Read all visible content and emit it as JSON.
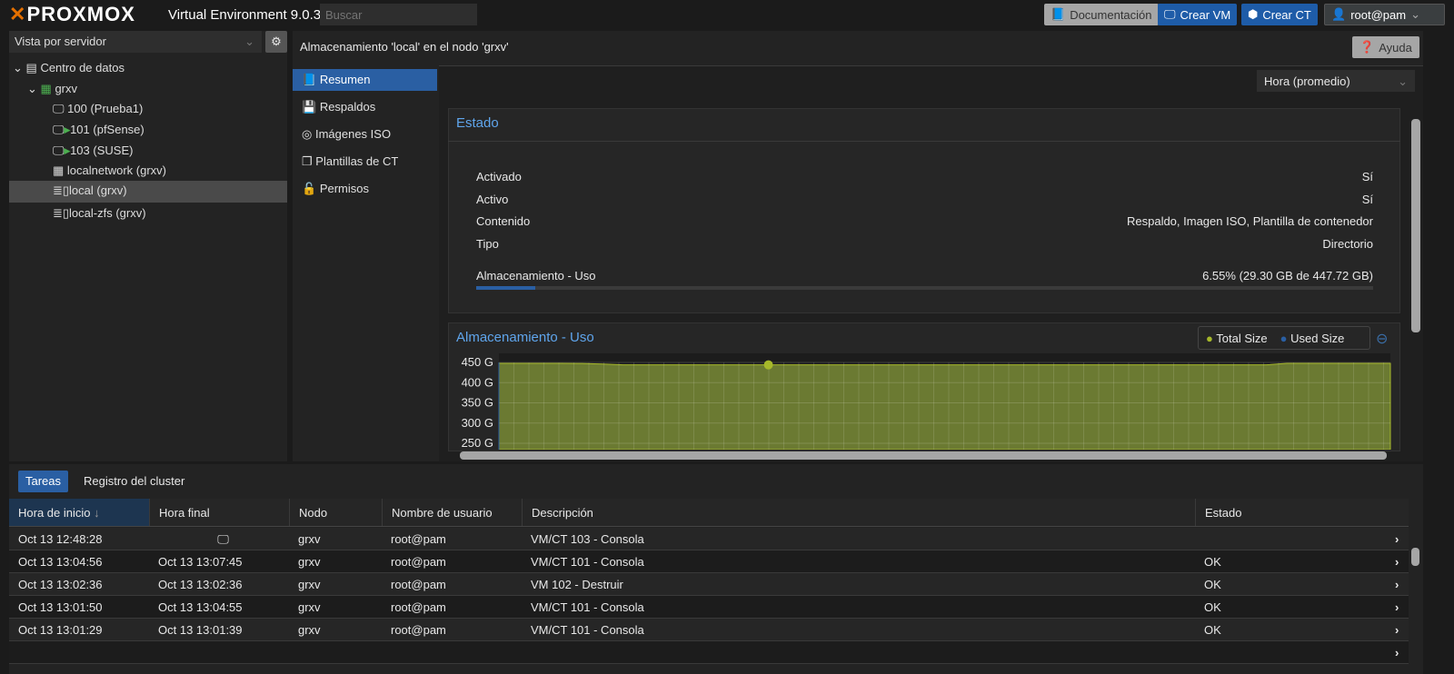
{
  "header": {
    "brand": "PROXMOX",
    "product": "Virtual Environment 9.0.3",
    "search_placeholder": "Buscar",
    "docs": "Documentación",
    "create_vm": "Crear VM",
    "create_ct": "Crear CT",
    "user": "root@pam"
  },
  "sidebar": {
    "view": "Vista por servidor",
    "tree": [
      {
        "label": "Centro de datos",
        "icon": "datacenter-icon"
      },
      {
        "label": "grxv",
        "icon": "node-online-icon"
      },
      {
        "label": "100 (Prueba1)",
        "icon": "vm-stopped-icon"
      },
      {
        "label": "101 (pfSense)",
        "icon": "vm-running-icon"
      },
      {
        "label": "103 (SUSE)",
        "icon": "vm-running-icon"
      },
      {
        "label": "localnetwork (grxv)",
        "icon": "network-icon"
      },
      {
        "label": "local (grxv)",
        "icon": "storage-icon",
        "selected": true
      },
      {
        "label": "local-zfs (grxv)",
        "icon": "storage-icon"
      }
    ]
  },
  "content": {
    "title": "Almacenamiento 'local' en el nodo 'grxv'",
    "help": "Ayuda",
    "nav": [
      "Resumen",
      "Respaldos",
      "Imágenes ISO",
      "Plantillas de CT",
      "Permisos"
    ],
    "timeframe": "Hora (promedio)"
  },
  "status": {
    "title": "Estado",
    "rows": [
      {
        "k": "Activado",
        "v": "Sí"
      },
      {
        "k": "Activo",
        "v": "Sí"
      },
      {
        "k": "Contenido",
        "v": "Respaldo, Imagen ISO, Plantilla de contenedor"
      },
      {
        "k": "Tipo",
        "v": "Directorio"
      }
    ],
    "usage_label": "Almacenamiento - Uso",
    "usage_text": "6.55% (29.30 GB de 447.72 GB)",
    "usage_pct": 6.55
  },
  "chart_data": {
    "type": "area",
    "title": "Almacenamiento - Uso",
    "yticks": [
      "450 G",
      "400 G",
      "350 G",
      "300 G",
      "250 G"
    ],
    "ylim": [
      250,
      460
    ],
    "series": [
      {
        "name": "Total Size",
        "color": "#a6b82a",
        "values": [
          447.7,
          447.7,
          447.7,
          447.7,
          447.5,
          446,
          444,
          444,
          444,
          444,
          444,
          444,
          444,
          444,
          444,
          444,
          444,
          444,
          444,
          444,
          444,
          444,
          444,
          444,
          444,
          444,
          444,
          444,
          444,
          444,
          444,
          444,
          444,
          444,
          444,
          444,
          444,
          444,
          447.7,
          447.7,
          447.7,
          447.7,
          447.7,
          447.7
        ]
      },
      {
        "name": "Used Size",
        "color": "#2a5fa3",
        "values": []
      }
    ],
    "grid": true,
    "legend": "top-right"
  },
  "tasks": {
    "tabs": [
      "Tareas",
      "Registro del cluster"
    ],
    "columns": [
      "Hora de inicio",
      "Hora final",
      "Nodo",
      "Nombre de usuario",
      "Descripción",
      "Estado"
    ],
    "rows": [
      [
        "Oct 13 12:48:28",
        "",
        "grxv",
        "root@pam",
        "VM/CT 103 - Consola",
        ""
      ],
      [
        "Oct 13 13:04:56",
        "Oct 13 13:07:45",
        "grxv",
        "root@pam",
        "VM/CT 101 - Consola",
        "OK"
      ],
      [
        "Oct 13 13:02:36",
        "Oct 13 13:02:36",
        "grxv",
        "root@pam",
        "VM 102 - Destruir",
        "OK"
      ],
      [
        "Oct 13 13:01:50",
        "Oct 13 13:04:55",
        "grxv",
        "root@pam",
        "VM/CT 101 - Consola",
        "OK"
      ],
      [
        "Oct 13 13:01:29",
        "Oct 13 13:01:39",
        "grxv",
        "root@pam",
        "VM/CT 101 - Consola",
        "OK"
      ]
    ]
  }
}
